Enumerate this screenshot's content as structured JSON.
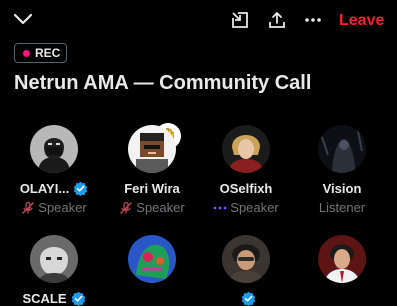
{
  "header": {
    "leave_label": "Leave"
  },
  "badge": {
    "label": "REC",
    "dot_color": "#f91880"
  },
  "space": {
    "title": "Netrun AMA — Community Call"
  },
  "participants": [
    {
      "name": "OLAYI...",
      "role": "Speaker",
      "verified": true,
      "status": "muted"
    },
    {
      "name": "Feri Wira",
      "role": "Speaker",
      "verified": false,
      "status": "muted",
      "hand_raised": true
    },
    {
      "name": "OSelfixh",
      "role": "Speaker",
      "verified": false,
      "status": "speaking"
    },
    {
      "name": "Vision",
      "role": "Listener",
      "verified": false
    },
    {
      "name": "SCALE",
      "verified": true
    },
    {
      "name": "",
      "verified": false
    },
    {
      "name": "",
      "verified": true
    },
    {
      "name": "",
      "verified": false
    }
  ],
  "colors": {
    "accent_red": "#f4212e",
    "verified_blue": "#1d9bf0",
    "muted_text": "#71767b"
  }
}
